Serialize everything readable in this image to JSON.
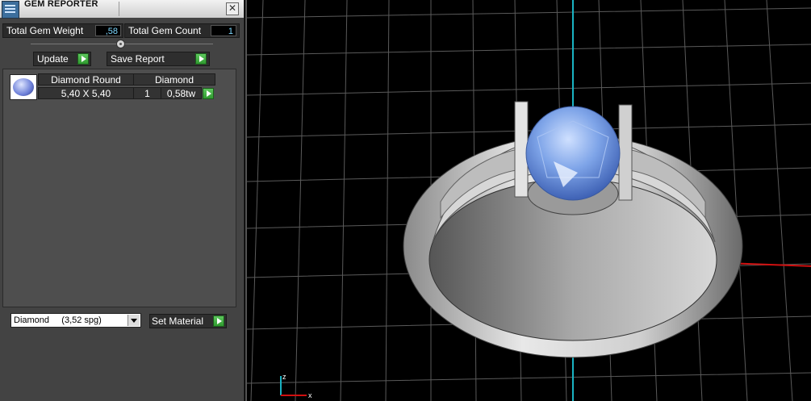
{
  "window": {
    "title": "GEM REPORTER",
    "close_glyph": "✕"
  },
  "metrics": {
    "total_weight_label": "Total Gem Weight",
    "total_weight_value": ",58",
    "total_count_label": "Total Gem Count",
    "total_count_value": "1"
  },
  "buttons": {
    "update": "Update",
    "save_report": "Save Report",
    "set_material": "Set Material"
  },
  "gem_list": {
    "headers": [
      "Diamond Round",
      "Diamond"
    ],
    "rows": [
      {
        "size": "5,40 X 5,40",
        "qty": "1",
        "weight": "0,58tw",
        "icon": "round-gem-icon"
      }
    ]
  },
  "material_select": {
    "value": "Diamond     (3,52 spg)"
  },
  "viewport": {
    "axis_labels": [
      "z",
      "x"
    ]
  },
  "colors": {
    "accent_value": "#7ed8ff",
    "play_green": "#3fae3f",
    "gem_blue": "#6f9be6",
    "axis_x": "#d01010",
    "axis_y": "#19b3c2"
  }
}
